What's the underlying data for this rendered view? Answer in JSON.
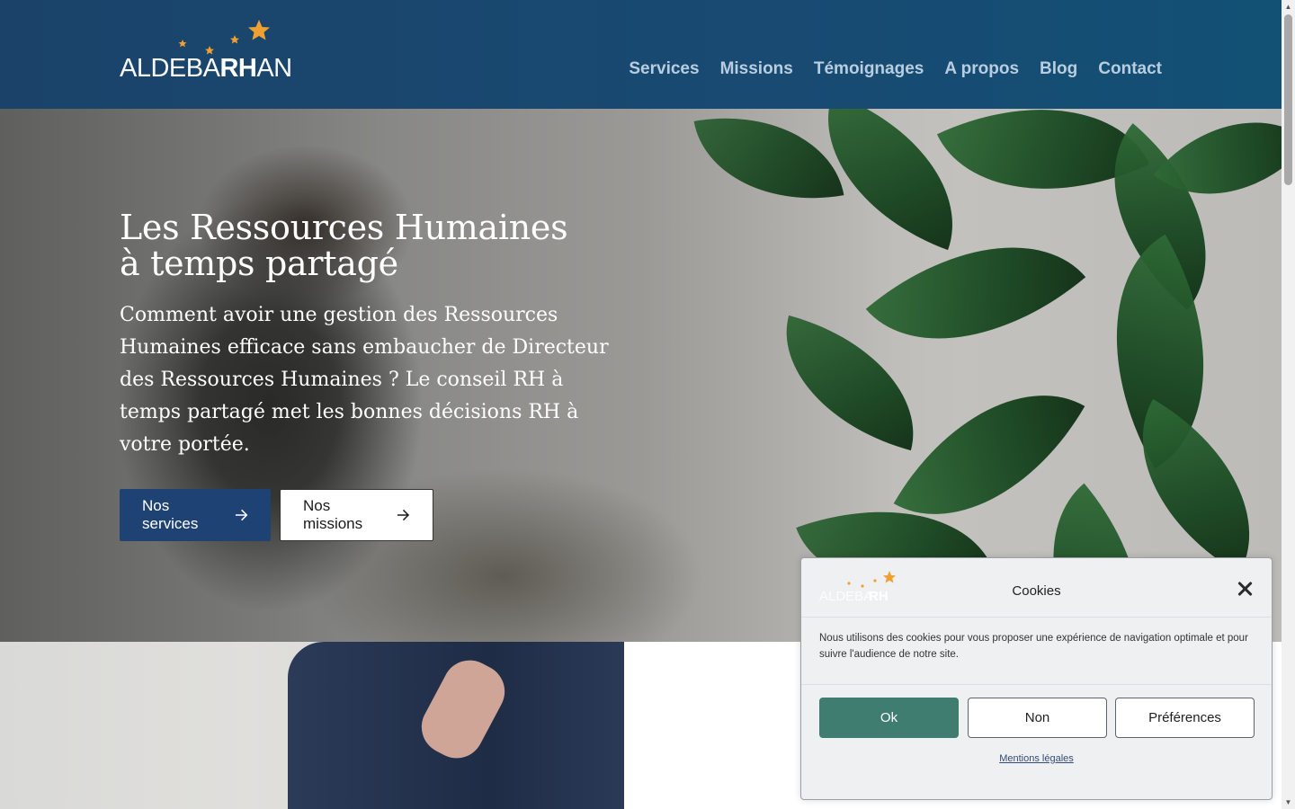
{
  "header": {
    "logo": {
      "thin_left": "ALDEBA",
      "bold": "RH",
      "thin_right": "AN"
    },
    "nav": [
      "Services",
      "Missions",
      "Témoignages",
      "A propos",
      "Blog",
      "Contact"
    ]
  },
  "hero": {
    "title_line1": "Les Ressources Humaines",
    "title_line2": "à temps partagé",
    "text": "Comment avoir une gestion des Ressources Humaines efficace sans embaucher de Directeur des Ressources Humaines ? Le conseil RH à temps partagé met les bonnes décisions RH à votre portée.",
    "buttons": {
      "primary": "Nos services",
      "secondary": "Nos missions"
    }
  },
  "cookie": {
    "title": "Cookies",
    "body": "Nous utilisons des cookies pour vous proposer une expérience de navigation optimale et pour suivre l'audience de notre site.",
    "ok": "Ok",
    "no": "Non",
    "preferences": "Préférences",
    "link": "Mentions légales"
  },
  "colors": {
    "header_bg": "#1b436a",
    "primary_button": "#1f4274",
    "cookie_ok": "#3f7d70",
    "star_orange": "#f0a030"
  },
  "icons": [
    "star-icon",
    "arrow-right-icon",
    "close-icon"
  ]
}
